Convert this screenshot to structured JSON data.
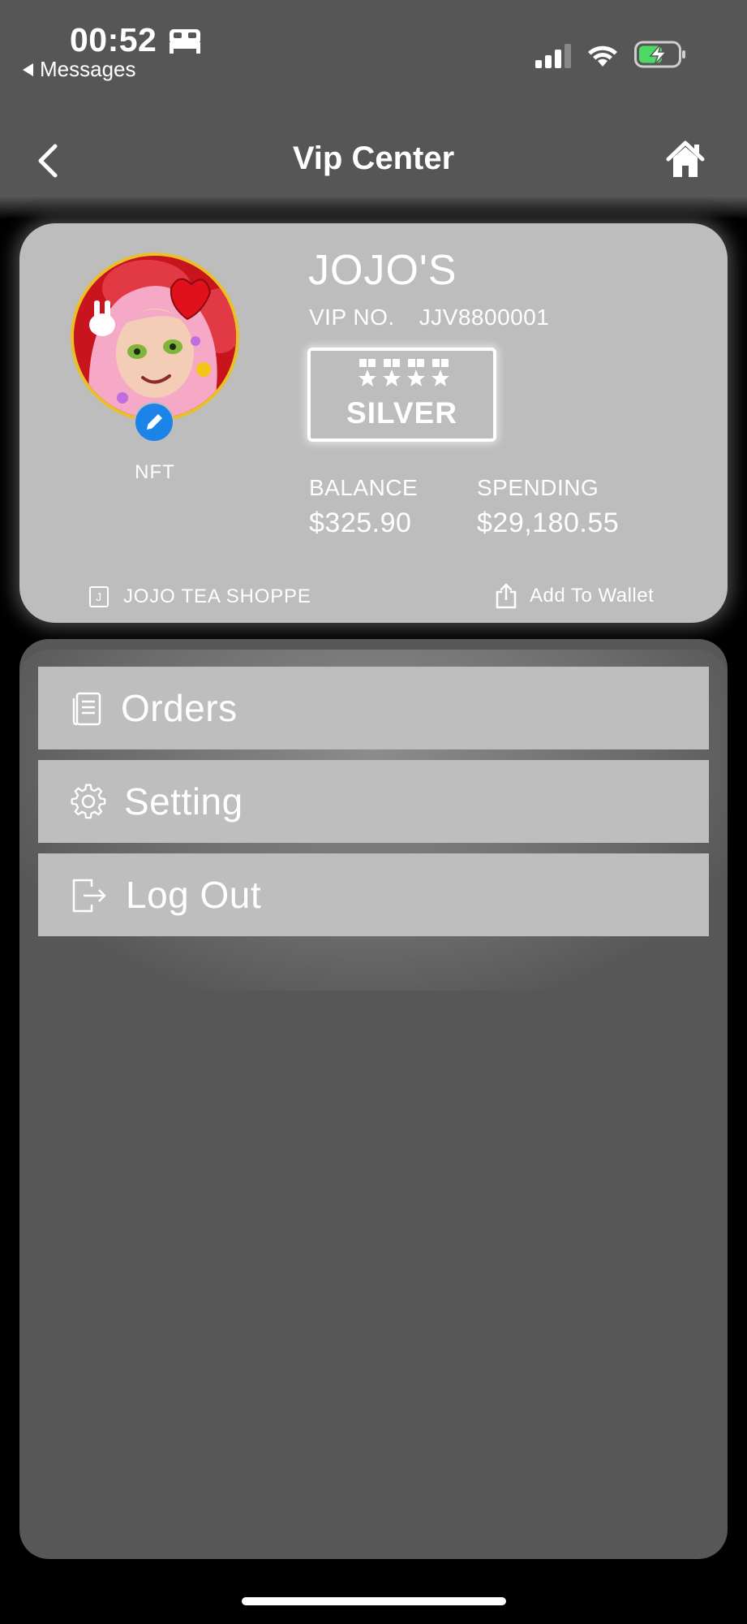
{
  "status_bar": {
    "time": "00:52",
    "back_app": "Messages",
    "icons": [
      "bed-icon",
      "cellular-signal-icon",
      "wifi-icon",
      "battery-charging-icon"
    ]
  },
  "nav": {
    "title": "Vip Center",
    "back_icon": "chevron-left-icon",
    "home_icon": "home-icon"
  },
  "card": {
    "name": "JOJO'S",
    "vip_no_label": "VIP NO.",
    "vip_no": "JJV8800001",
    "tier": "SILVER",
    "tier_medals": 4,
    "avatar_label": "NFT",
    "balance_label": "BALANCE",
    "balance_value": "$325.90",
    "spending_label": "SPENDING",
    "spending_value": "$29,180.55",
    "shop_icon_letter": "J",
    "shop_name": "JOJO TEA SHOPPE",
    "wallet_label": "Add To Wallet"
  },
  "menu": [
    {
      "label": "Orders",
      "icon": "document-icon"
    },
    {
      "label": "Setting",
      "icon": "gear-icon"
    },
    {
      "label": "Log Out",
      "icon": "logout-icon"
    }
  ],
  "colors": {
    "card_bg": "#bdbdbd",
    "panel_bg": "#575757",
    "edit_badge": "#1c84e8",
    "avatar_ring": "#e9c026",
    "battery_fill": "#4cd964"
  }
}
